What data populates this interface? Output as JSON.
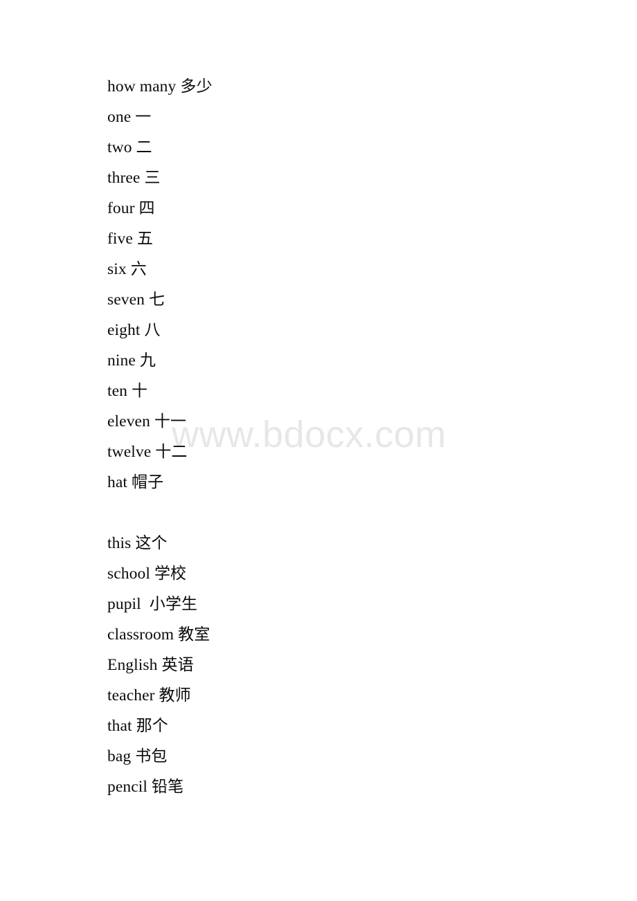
{
  "document": {
    "background_color": "#ffffff",
    "text_color": "#0b0b0b",
    "watermark": {
      "text": "www.bdocx.com",
      "color": "#e7e7e7"
    },
    "lines": [
      {
        "en": "how many",
        "sep": " ",
        "zh": "多少"
      },
      {
        "en": "one",
        "sep": " ",
        "zh": "一"
      },
      {
        "en": "two",
        "sep": " ",
        "zh": "二"
      },
      {
        "en": "three",
        "sep": " ",
        "zh": "三"
      },
      {
        "en": "four",
        "sep": " ",
        "zh": "四"
      },
      {
        "en": "five",
        "sep": " ",
        "zh": "五"
      },
      {
        "en": "six",
        "sep": " ",
        "zh": "六"
      },
      {
        "en": "seven",
        "sep": " ",
        "zh": "七"
      },
      {
        "en": "eight",
        "sep": " ",
        "zh": "八"
      },
      {
        "en": "nine",
        "sep": " ",
        "zh": "九"
      },
      {
        "en": "ten",
        "sep": " ",
        "zh": "十"
      },
      {
        "en": "eleven",
        "sep": " ",
        "zh": "十一"
      },
      {
        "en": "twelve",
        "sep": " ",
        "zh": "十二"
      },
      {
        "en": "hat",
        "sep": " ",
        "zh": "帽子"
      },
      {
        "en": "",
        "sep": "",
        "zh": ""
      },
      {
        "en": "this",
        "sep": " ",
        "zh": "这个"
      },
      {
        "en": "school",
        "sep": " ",
        "zh": "学校"
      },
      {
        "en": "pupil",
        "sep": "  ",
        "zh": "小学生"
      },
      {
        "en": "classroom",
        "sep": " ",
        "zh": "教室"
      },
      {
        "en": "English",
        "sep": " ",
        "zh": "英语"
      },
      {
        "en": "teacher",
        "sep": " ",
        "zh": "教师"
      },
      {
        "en": "that",
        "sep": " ",
        "zh": "那个"
      },
      {
        "en": "bag",
        "sep": " ",
        "zh": "书包"
      },
      {
        "en": "pencil",
        "sep": " ",
        "zh": "铅笔"
      }
    ]
  }
}
